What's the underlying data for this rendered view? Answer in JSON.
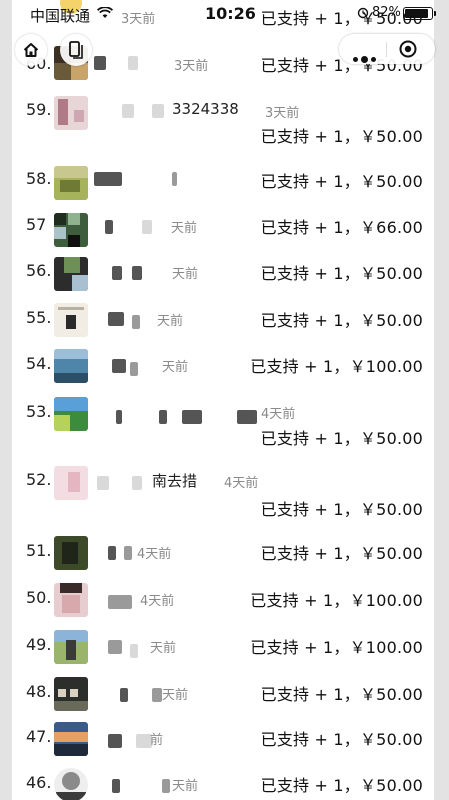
{
  "status_bar": {
    "carrier": "中国联通",
    "time": "10:26",
    "battery": "82%"
  },
  "top_right_amount": "已支持 + 1，￥50.00",
  "top_left_time": "3天前",
  "entries": [
    {
      "rank": "60.",
      "time": "3天前",
      "amount": "已支持 + 1，￥50.00"
    },
    {
      "rank": "59.",
      "name": "3324338",
      "time": "3天前",
      "amount": "已支持 + 1，￥50.00"
    },
    {
      "rank": "58.",
      "amount": "已支持 + 1，￥50.00"
    },
    {
      "rank": "57",
      "time": "天前",
      "amount": "已支持 + 1，￥66.00"
    },
    {
      "rank": "56.",
      "time": "天前",
      "amount": "已支持 + 1，￥50.00"
    },
    {
      "rank": "55.",
      "time": "天前",
      "amount": "已支持 + 1，￥50.00"
    },
    {
      "rank": "54.",
      "time": "天前",
      "amount": "已支持 + 1，￥100.00"
    },
    {
      "rank": "53.",
      "time": "4天前",
      "amount": "已支持 + 1，￥50.00"
    },
    {
      "rank": "52.",
      "name": "南去措",
      "time": "4天前",
      "amount": "已支持 + 1，￥50.00"
    },
    {
      "rank": "51.",
      "time": "4天前",
      "amount": "已支持 + 1，￥50.00"
    },
    {
      "rank": "50.",
      "time": "4天前",
      "amount": "已支持 + 1，￥100.00"
    },
    {
      "rank": "49.",
      "time": "天前",
      "amount": "已支持 + 1，￥100.00"
    },
    {
      "rank": "48.",
      "time": "天前",
      "amount": "已支持 + 1，￥50.00"
    },
    {
      "rank": "47.",
      "time": "前",
      "amount": "已支持 + 1，￥50.00"
    },
    {
      "rank": "46.",
      "time": "天前",
      "amount": "已支持 + 1，￥50.00"
    }
  ]
}
